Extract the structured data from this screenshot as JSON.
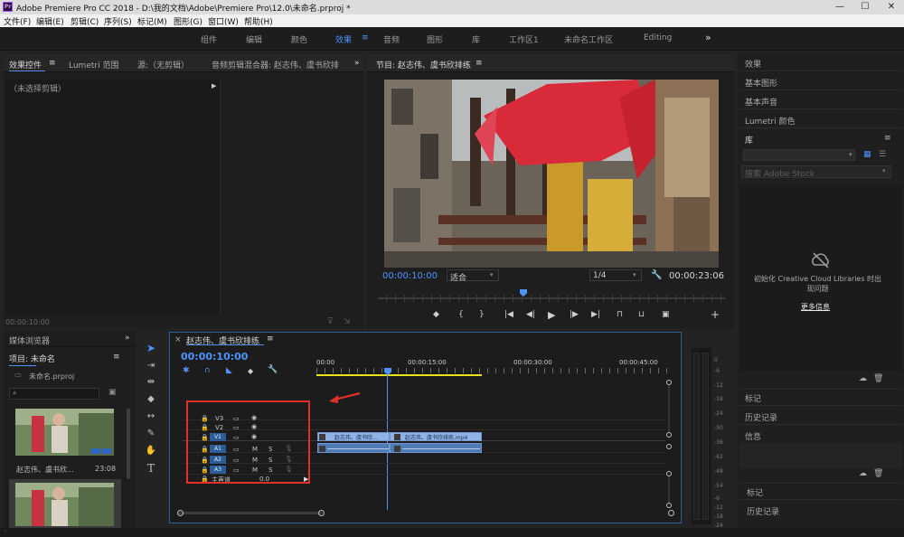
{
  "titlebar": {
    "app_icon": "Pr",
    "title": "Adobe Premiere Pro CC 2018 - D:\\我的文档\\Adobe\\Premiere Pro\\12.0\\未命名.prproj *",
    "minimize": "—",
    "maximize": "☐",
    "close": "✕"
  },
  "menu": {
    "file": "文件(F)",
    "edit": "编辑(E)",
    "clip": "剪辑(C)",
    "sequence": "序列(S)",
    "marker": "标记(M)",
    "graphics": "图形(G)",
    "window": "窗口(W)",
    "help": "帮助(H)"
  },
  "workspaces": {
    "assembly": "组件",
    "editing": "编辑",
    "color": "颜色",
    "effects": "效果",
    "effects_menu": "≡",
    "audio": "音频",
    "graphics": "图形",
    "library": "库",
    "ws1": "工作区1",
    "untitled": "未命名工作区",
    "editing_en": "Editing",
    "more": "»"
  },
  "source_panel": {
    "tab_effect_controls": "效果控件",
    "tab_menu": "≡",
    "tab_lumetri": "Lumetri 范围",
    "tab_source": "源:（无剪辑）",
    "tab_audio_mixer": "音频剪辑混合器: 赵志伟、虞书欣排",
    "more": "»",
    "no_clip": "（未选择剪辑）",
    "timecode": "00:00:10:00"
  },
  "program_monitor": {
    "title": "节目: 赵志伟、虞书欣排练",
    "menu": "≡",
    "timecode": "00:00:10:00",
    "fit": "适合",
    "resolution": "1/4",
    "duration": "00:00:23:06",
    "add": "+"
  },
  "project_panel": {
    "tab_media_browser": "媒体浏览器",
    "more": "»",
    "project_label": "项目: 未命名",
    "project_menu": "≡",
    "file_name": "未命名.prproj",
    "clips": [
      {
        "name": "赵志伟、虞书欣...",
        "duration": "23:08"
      }
    ]
  },
  "timeline": {
    "close": "×",
    "sequence_name": "赵志伟、虞书欣排练",
    "menu": "≡",
    "timecode": "00:00:10:00",
    "ruler": [
      "00:00",
      "00:00:15:00",
      "00:00:30:00",
      "00:00:45:00"
    ],
    "video_tracks": [
      "V3",
      "V2",
      "V1"
    ],
    "audio_tracks": [
      "A1",
      "A2",
      "A3"
    ],
    "mute": "M",
    "solo": "S",
    "master_label": "主声道",
    "master_value": "0.0",
    "clip_v1_a": "赵志伟、虞书欣...",
    "clip_v1_b": "赵志伟、虞书欣排练.mp4"
  },
  "right_panels": {
    "effects": "效果",
    "essential_graphics": "基本图形",
    "essential_sound": "基本声音",
    "lumetri_color": "Lumetri 颜色",
    "libraries": "库",
    "libraries_menu": "≡",
    "search_placeholder": "搜索 Adobe Stock",
    "cc_message": "初始化 Creative Cloud Libraries 时出现问题",
    "more_info": "更多信息",
    "markers": "标记",
    "history": "历史记录",
    "info": "信息",
    "markers2": "标记",
    "history2": "历史记录"
  },
  "meter": {
    "labels": [
      "0",
      "-6",
      "-12",
      "-18",
      "-24",
      "-30",
      "-36",
      "-42",
      "-48",
      "-54"
    ],
    "labels_b": [
      "-6",
      "-12",
      "-18",
      "-24"
    ]
  },
  "colors": {
    "accent": "#4e93ff",
    "highlight_box": "#e0302a",
    "clip_video": "#8fb3e6",
    "clip_audio": "#4f7bb7",
    "work_area": "#e9e31e"
  }
}
